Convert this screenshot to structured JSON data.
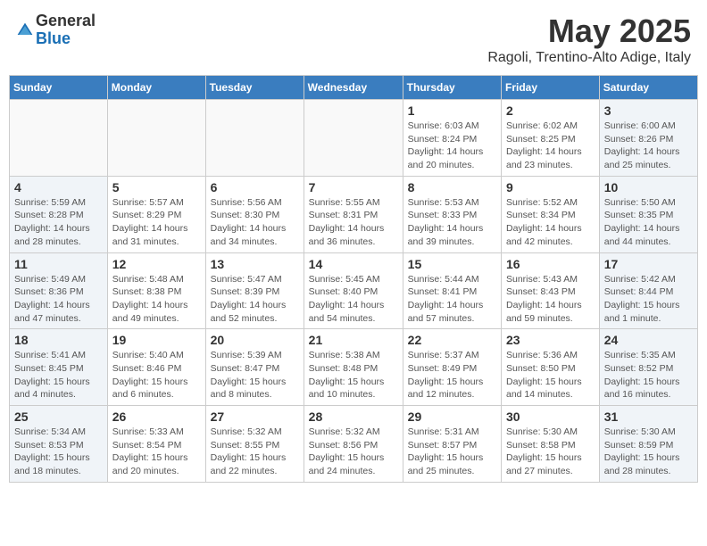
{
  "header": {
    "logo_general": "General",
    "logo_blue": "Blue",
    "month_year": "May 2025",
    "location": "Ragoli, Trentino-Alto Adige, Italy"
  },
  "days_of_week": [
    "Sunday",
    "Monday",
    "Tuesday",
    "Wednesday",
    "Thursday",
    "Friday",
    "Saturday"
  ],
  "weeks": [
    [
      {
        "num": "",
        "detail": ""
      },
      {
        "num": "",
        "detail": ""
      },
      {
        "num": "",
        "detail": ""
      },
      {
        "num": "",
        "detail": ""
      },
      {
        "num": "1",
        "detail": "Sunrise: 6:03 AM\nSunset: 8:24 PM\nDaylight: 14 hours\nand 20 minutes."
      },
      {
        "num": "2",
        "detail": "Sunrise: 6:02 AM\nSunset: 8:25 PM\nDaylight: 14 hours\nand 23 minutes."
      },
      {
        "num": "3",
        "detail": "Sunrise: 6:00 AM\nSunset: 8:26 PM\nDaylight: 14 hours\nand 25 minutes."
      }
    ],
    [
      {
        "num": "4",
        "detail": "Sunrise: 5:59 AM\nSunset: 8:28 PM\nDaylight: 14 hours\nand 28 minutes."
      },
      {
        "num": "5",
        "detail": "Sunrise: 5:57 AM\nSunset: 8:29 PM\nDaylight: 14 hours\nand 31 minutes."
      },
      {
        "num": "6",
        "detail": "Sunrise: 5:56 AM\nSunset: 8:30 PM\nDaylight: 14 hours\nand 34 minutes."
      },
      {
        "num": "7",
        "detail": "Sunrise: 5:55 AM\nSunset: 8:31 PM\nDaylight: 14 hours\nand 36 minutes."
      },
      {
        "num": "8",
        "detail": "Sunrise: 5:53 AM\nSunset: 8:33 PM\nDaylight: 14 hours\nand 39 minutes."
      },
      {
        "num": "9",
        "detail": "Sunrise: 5:52 AM\nSunset: 8:34 PM\nDaylight: 14 hours\nand 42 minutes."
      },
      {
        "num": "10",
        "detail": "Sunrise: 5:50 AM\nSunset: 8:35 PM\nDaylight: 14 hours\nand 44 minutes."
      }
    ],
    [
      {
        "num": "11",
        "detail": "Sunrise: 5:49 AM\nSunset: 8:36 PM\nDaylight: 14 hours\nand 47 minutes."
      },
      {
        "num": "12",
        "detail": "Sunrise: 5:48 AM\nSunset: 8:38 PM\nDaylight: 14 hours\nand 49 minutes."
      },
      {
        "num": "13",
        "detail": "Sunrise: 5:47 AM\nSunset: 8:39 PM\nDaylight: 14 hours\nand 52 minutes."
      },
      {
        "num": "14",
        "detail": "Sunrise: 5:45 AM\nSunset: 8:40 PM\nDaylight: 14 hours\nand 54 minutes."
      },
      {
        "num": "15",
        "detail": "Sunrise: 5:44 AM\nSunset: 8:41 PM\nDaylight: 14 hours\nand 57 minutes."
      },
      {
        "num": "16",
        "detail": "Sunrise: 5:43 AM\nSunset: 8:43 PM\nDaylight: 14 hours\nand 59 minutes."
      },
      {
        "num": "17",
        "detail": "Sunrise: 5:42 AM\nSunset: 8:44 PM\nDaylight: 15 hours\nand 1 minute."
      }
    ],
    [
      {
        "num": "18",
        "detail": "Sunrise: 5:41 AM\nSunset: 8:45 PM\nDaylight: 15 hours\nand 4 minutes."
      },
      {
        "num": "19",
        "detail": "Sunrise: 5:40 AM\nSunset: 8:46 PM\nDaylight: 15 hours\nand 6 minutes."
      },
      {
        "num": "20",
        "detail": "Sunrise: 5:39 AM\nSunset: 8:47 PM\nDaylight: 15 hours\nand 8 minutes."
      },
      {
        "num": "21",
        "detail": "Sunrise: 5:38 AM\nSunset: 8:48 PM\nDaylight: 15 hours\nand 10 minutes."
      },
      {
        "num": "22",
        "detail": "Sunrise: 5:37 AM\nSunset: 8:49 PM\nDaylight: 15 hours\nand 12 minutes."
      },
      {
        "num": "23",
        "detail": "Sunrise: 5:36 AM\nSunset: 8:50 PM\nDaylight: 15 hours\nand 14 minutes."
      },
      {
        "num": "24",
        "detail": "Sunrise: 5:35 AM\nSunset: 8:52 PM\nDaylight: 15 hours\nand 16 minutes."
      }
    ],
    [
      {
        "num": "25",
        "detail": "Sunrise: 5:34 AM\nSunset: 8:53 PM\nDaylight: 15 hours\nand 18 minutes."
      },
      {
        "num": "26",
        "detail": "Sunrise: 5:33 AM\nSunset: 8:54 PM\nDaylight: 15 hours\nand 20 minutes."
      },
      {
        "num": "27",
        "detail": "Sunrise: 5:32 AM\nSunset: 8:55 PM\nDaylight: 15 hours\nand 22 minutes."
      },
      {
        "num": "28",
        "detail": "Sunrise: 5:32 AM\nSunset: 8:56 PM\nDaylight: 15 hours\nand 24 minutes."
      },
      {
        "num": "29",
        "detail": "Sunrise: 5:31 AM\nSunset: 8:57 PM\nDaylight: 15 hours\nand 25 minutes."
      },
      {
        "num": "30",
        "detail": "Sunrise: 5:30 AM\nSunset: 8:58 PM\nDaylight: 15 hours\nand 27 minutes."
      },
      {
        "num": "31",
        "detail": "Sunrise: 5:30 AM\nSunset: 8:59 PM\nDaylight: 15 hours\nand 28 minutes."
      }
    ]
  ]
}
